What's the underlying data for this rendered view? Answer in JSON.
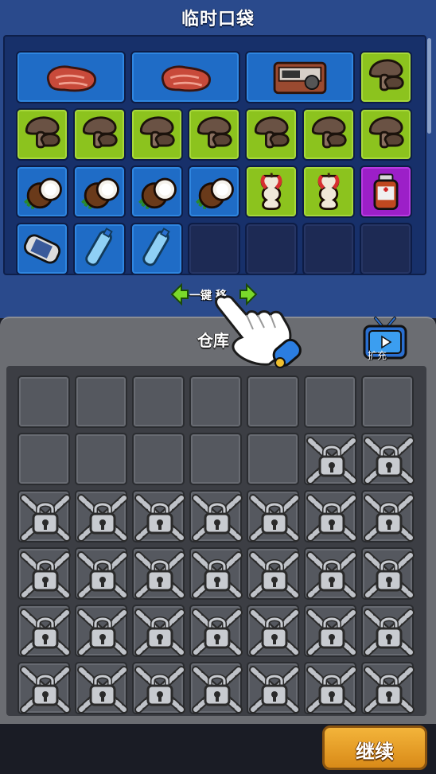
{
  "temp_bag": {
    "title": "临时口袋",
    "rows": [
      [
        {
          "item": "meat-icon",
          "color": "blue",
          "span": 2
        },
        {
          "item": "meat-icon",
          "color": "blue",
          "span": 2
        },
        {
          "item": "camera-icon",
          "color": "blue",
          "span": 2
        },
        {
          "item": "mushroom-icon",
          "color": "green",
          "span": 1
        }
      ],
      [
        {
          "item": "mushroom-icon",
          "color": "green",
          "span": 1
        },
        {
          "item": "mushroom-icon",
          "color": "green",
          "span": 1
        },
        {
          "item": "mushroom-icon",
          "color": "green",
          "span": 1
        },
        {
          "item": "mushroom-icon",
          "color": "green",
          "span": 1
        },
        {
          "item": "mushroom-icon",
          "color": "green",
          "span": 1
        },
        {
          "item": "mushroom-icon",
          "color": "green",
          "span": 1
        },
        {
          "item": "mushroom-icon",
          "color": "green",
          "span": 1
        }
      ],
      [
        {
          "item": "coconut-icon",
          "color": "blue",
          "span": 1
        },
        {
          "item": "coconut-icon",
          "color": "blue",
          "span": 1
        },
        {
          "item": "coconut-icon",
          "color": "blue",
          "span": 1
        },
        {
          "item": "coconut-icon",
          "color": "blue",
          "span": 1
        },
        {
          "item": "apple-core-icon",
          "color": "green",
          "span": 1
        },
        {
          "item": "apple-core-icon",
          "color": "green",
          "span": 1
        },
        {
          "item": "medicine-bottle-icon",
          "color": "purple",
          "span": 1
        }
      ],
      [
        {
          "item": "can-icon",
          "color": "blue",
          "span": 1
        },
        {
          "item": "water-bottle-icon",
          "color": "blue",
          "span": 1
        },
        {
          "item": "water-bottle-icon",
          "color": "blue",
          "span": 1
        },
        {
          "item": "",
          "color": "empty",
          "span": 1
        },
        {
          "item": "",
          "color": "empty",
          "span": 1
        },
        {
          "item": "",
          "color": "empty",
          "span": 1
        },
        {
          "item": "",
          "color": "empty",
          "span": 1
        }
      ]
    ]
  },
  "transfer": {
    "label": "一键转移",
    "visible_label": "一键 移"
  },
  "warehouse": {
    "title": "仓库",
    "visible_title": "仓库",
    "expand_label": "扩充",
    "unlocked_slots": 12,
    "total_slots": 42,
    "columns": 7
  },
  "continue_label": "继续",
  "colors": {
    "bag_bg": "#2a4a8c",
    "slot_blue": "#1f6cc6",
    "slot_green": "#8cc31e",
    "slot_purple": "#9c1fc8",
    "warehouse_bg": "#6b6d72",
    "continue_btn": "#f0a830"
  }
}
